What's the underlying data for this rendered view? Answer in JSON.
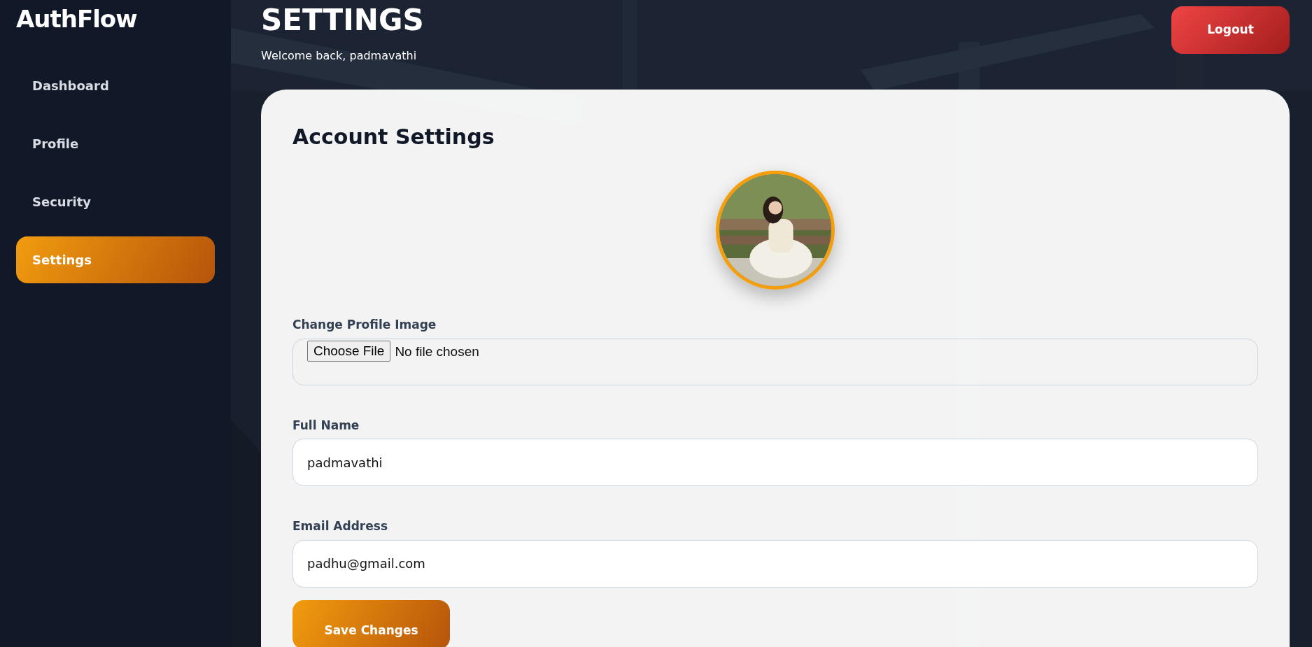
{
  "sidebar": {
    "brand": "AuthFlow",
    "items": [
      {
        "label": "Dashboard",
        "selected": false
      },
      {
        "label": "Profile",
        "selected": false
      },
      {
        "label": "Security",
        "selected": false
      },
      {
        "label": "Settings",
        "selected": true
      }
    ]
  },
  "header": {
    "title": "SETTINGS",
    "subtitle": "Welcome back, padmavathi",
    "logout": "Logout"
  },
  "card": {
    "title": "Account Settings",
    "fields": [
      {
        "kind": "file",
        "label": "Change Profile Image",
        "button": "Choose File",
        "status": "No file chosen"
      },
      {
        "kind": "text",
        "label": "Full Name",
        "value": "padmavathi"
      },
      {
        "kind": "text",
        "label": "Email Address",
        "value": "padhu@gmail.com"
      }
    ],
    "save": "Save Changes"
  }
}
